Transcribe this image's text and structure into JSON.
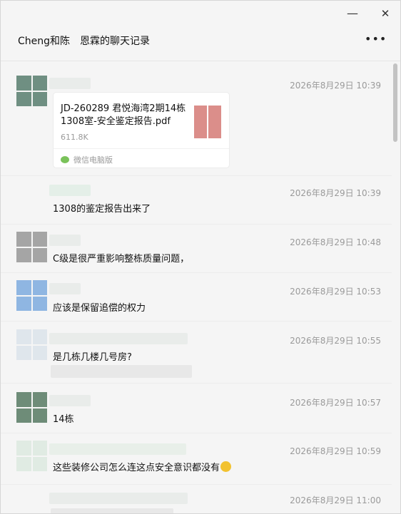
{
  "window": {
    "minimize_icon": "minimize-icon",
    "close_icon": "close-icon",
    "more_icon": "more-icon"
  },
  "header": {
    "chat_name": "Cheng和陈",
    "record_title": "恩霖的聊天记录",
    "more_label": "•••",
    "minimize_label": "—",
    "close_label": "✕"
  },
  "colors": {
    "file_icon": "#db8e8a",
    "wechat_green": "#7ac25a",
    "time_gray": "#9a9a9a"
  },
  "messages": [
    {
      "time": "2026年8月29日 10:39",
      "avatar_colors": [
        "#6f8f82",
        "#6f8f82",
        "#6f8f82",
        "#6f8f82"
      ],
      "file": {
        "name": "JD-260289 君悦海湾2期14栋1308室-安全鉴定报告.pdf",
        "size": "611.8K",
        "source": "微信电脑版",
        "icon": "pdf-file-icon"
      }
    },
    {
      "time": "2026年8月29日 10:39",
      "text": "1308的鉴定报告出来了"
    },
    {
      "time": "2026年8月29日 10:48",
      "text": "C级是很严重影响整栋质量问题，",
      "avatar_colors": [
        "#a5a5a5",
        "#a5a5a5",
        "#a5a5a5",
        "#a5a5a5"
      ]
    },
    {
      "time": "2026年8月29日 10:53",
      "text": "应该是保留追偿的权力",
      "avatar_colors": [
        "#8fb6e2",
        "#8fb6e2",
        "#8fb6e2",
        "#8fb6e2"
      ]
    },
    {
      "time": "2026年8月29日 10:55",
      "text": "是几栋几楼几号房?",
      "avatar_colors": [
        "#dfe6ec",
        "#dfe6ec",
        "#dfe6ec",
        "#dfe6ec"
      ]
    },
    {
      "time": "2026年8月29日 10:57",
      "text": "14栋",
      "avatar_colors": [
        "#6e8c78",
        "#6e8c78",
        "#6e8c78",
        "#6e8c78"
      ]
    },
    {
      "time": "2026年8月29日 10:59",
      "text": "这些装修公司怎么连这点安全意识都没有",
      "emoji": "grimace-emoji",
      "avatar_colors": [
        "#e0ebe3",
        "#e0ebe3",
        "#e0ebe3",
        "#e0ebe3"
      ]
    },
    {
      "time": "2026年8月29日 11:00",
      "text": ""
    }
  ]
}
